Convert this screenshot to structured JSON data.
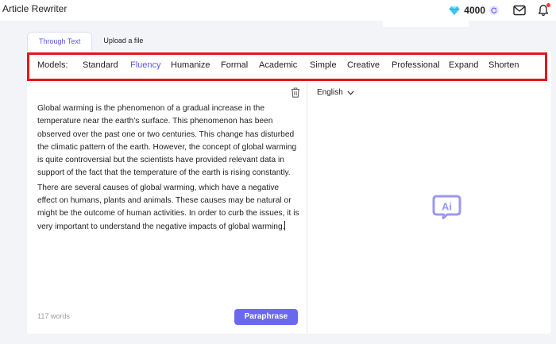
{
  "app": {
    "title": "Article Rewriter"
  },
  "header": {
    "credits": "4000",
    "colors": {
      "gem": "#3fc3f0",
      "notification_dot": "#ef3b3b"
    }
  },
  "source_tabs": [
    {
      "label": "Through Text",
      "active": true
    },
    {
      "label": "Upload a file",
      "active": false
    }
  ],
  "models": {
    "label": "Models:",
    "items": [
      {
        "label": "Standard",
        "active": false
      },
      {
        "label": "Fluency",
        "active": true
      },
      {
        "label": "Humanize",
        "active": false
      },
      {
        "label": "Formal",
        "active": false
      },
      {
        "label": "Academic",
        "active": false
      },
      {
        "label": "Simple",
        "active": false
      },
      {
        "label": "Creative",
        "active": false
      },
      {
        "label": "Professional",
        "active": false
      },
      {
        "label": "Expand",
        "active": false
      },
      {
        "label": "Shorten",
        "active": false
      }
    ]
  },
  "editor": {
    "paragraphs": [
      "Global warming is the phenomenon of a gradual increase in the temperature near the earth’s surface. This phenomenon has been observed over the past one or two centuries. This change has disturbed the climatic pattern of the earth. However, the concept of global warming is quite controversial but the scientists have provided relevant data in support of the fact that the temperature of the earth is rising constantly.",
      "There are several causes of global warming, which have a negative effect on humans, plants and animals. These causes may be natural or might be the outcome of human activities. In order to curb the issues, it is very important to understand the negative impacts of global warming."
    ],
    "word_count": "117 words",
    "paraphrase_label": "Paraphrase"
  },
  "output": {
    "language": "English",
    "logo_text": "Ai"
  },
  "colors": {
    "accent": "#5b56e6",
    "button": "#6b68f0",
    "highlight": "#e2171b",
    "logo": "#9c98f4"
  },
  "icons": {
    "gem": "gem-icon",
    "refresh": "refresh-icon",
    "mail": "mail-icon",
    "bell": "bell-icon",
    "trash": "trash-icon",
    "chevron": "chevron-down-icon",
    "logo": "ai-logo-icon"
  }
}
